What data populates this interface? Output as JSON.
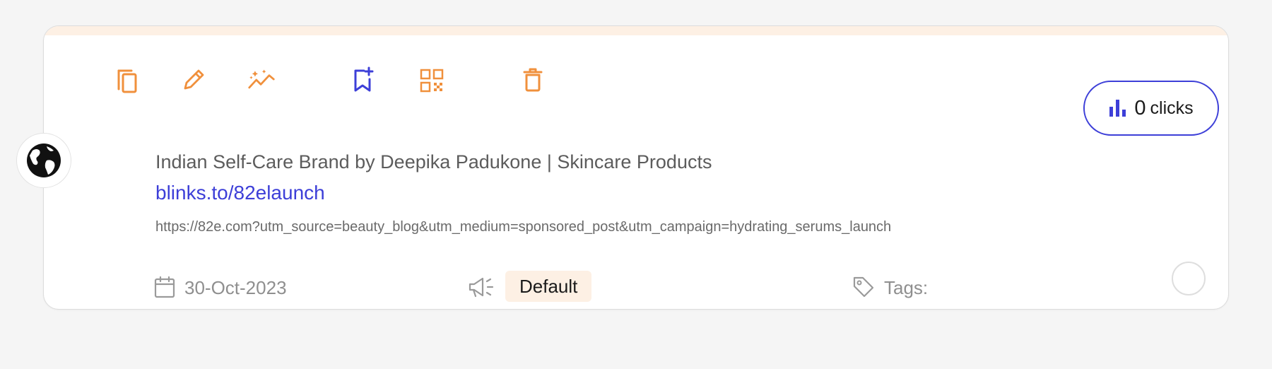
{
  "card": {
    "title": "Indian Self-Care Brand by Deepika Padukone | Skincare Products",
    "short_link": "blinks.to/82elaunch",
    "destination_url": "https://82e.com?utm_source=beauty_blog&utm_medium=sponsored_post&utm_campaign=hydrating_serums_launch",
    "clicks": {
      "count": "0",
      "label": "clicks"
    },
    "created_date": "30-Oct-2023",
    "campaign": "Default",
    "tags_label": "Tags:"
  },
  "actions": [
    {
      "name": "copy-icon"
    },
    {
      "name": "edit-icon"
    },
    {
      "name": "analytics-icon"
    },
    {
      "name": "bookmark-add-icon"
    },
    {
      "name": "qr-code-icon"
    },
    {
      "name": "delete-icon"
    }
  ],
  "colors": {
    "accent_orange": "#f0903c",
    "accent_blue": "#3d3fd8",
    "header_tint": "#fdf0e4",
    "badge_bg": "#fdf0e4"
  }
}
